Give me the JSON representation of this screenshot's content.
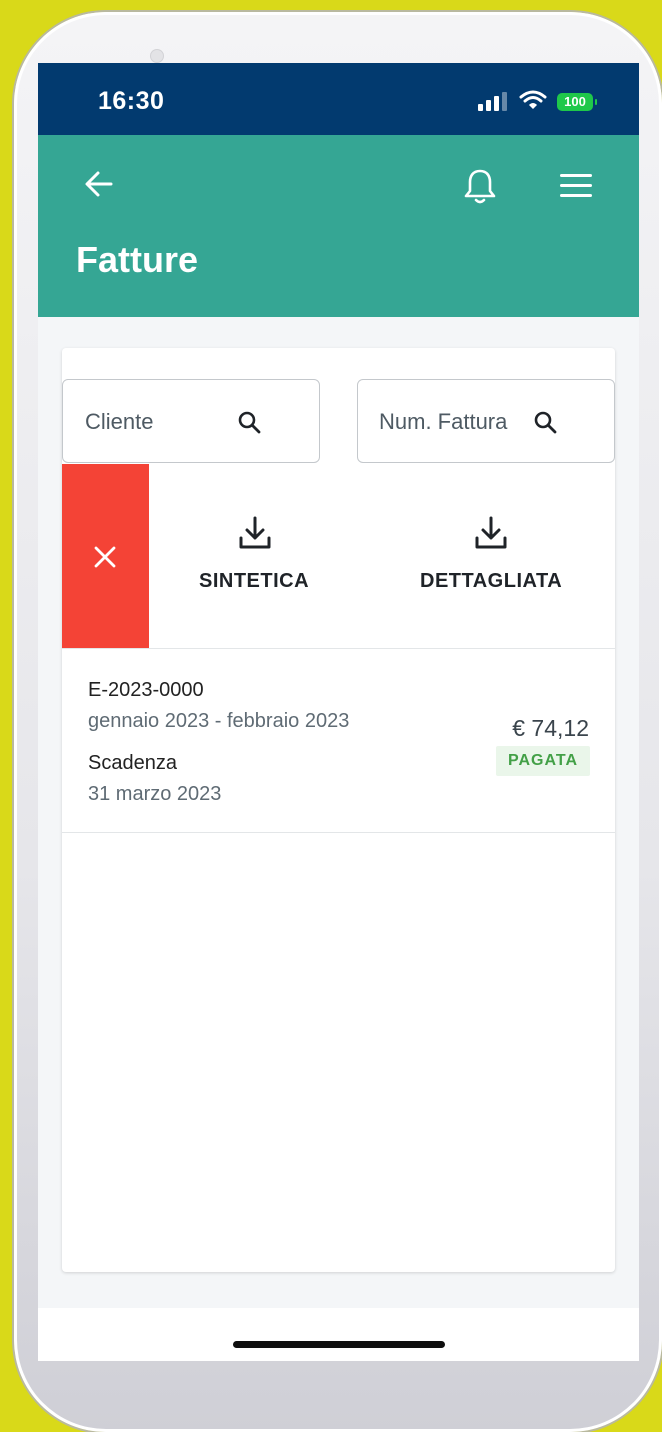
{
  "status_bar": {
    "time": "16:30",
    "battery": "100",
    "icons": [
      "signal-icon",
      "wifi-icon",
      "battery-icon"
    ]
  },
  "header": {
    "title": "Fatture",
    "icons": [
      "back-arrow-icon",
      "bell-icon",
      "hamburger-menu-icon"
    ],
    "color": "#35a694"
  },
  "search": {
    "client_placeholder": "Cliente",
    "invoice_placeholder": "Num. Fattura"
  },
  "actions": {
    "close_color": "#f44336",
    "download_summary_label": "SINTETICA",
    "download_detailed_label": "DETTAGLIATA"
  },
  "invoices": [
    {
      "code": "E-2023-0000",
      "period": "gennaio 2023 - febbraio 2023",
      "due_label": "Scadenza",
      "due_date": "31 marzo 2023",
      "amount": "€ 74,12",
      "status": "PAGATA",
      "status_color": "#43a047"
    }
  ],
  "colors": {
    "status_bar": "#023a6f",
    "background": "#d9d919"
  }
}
